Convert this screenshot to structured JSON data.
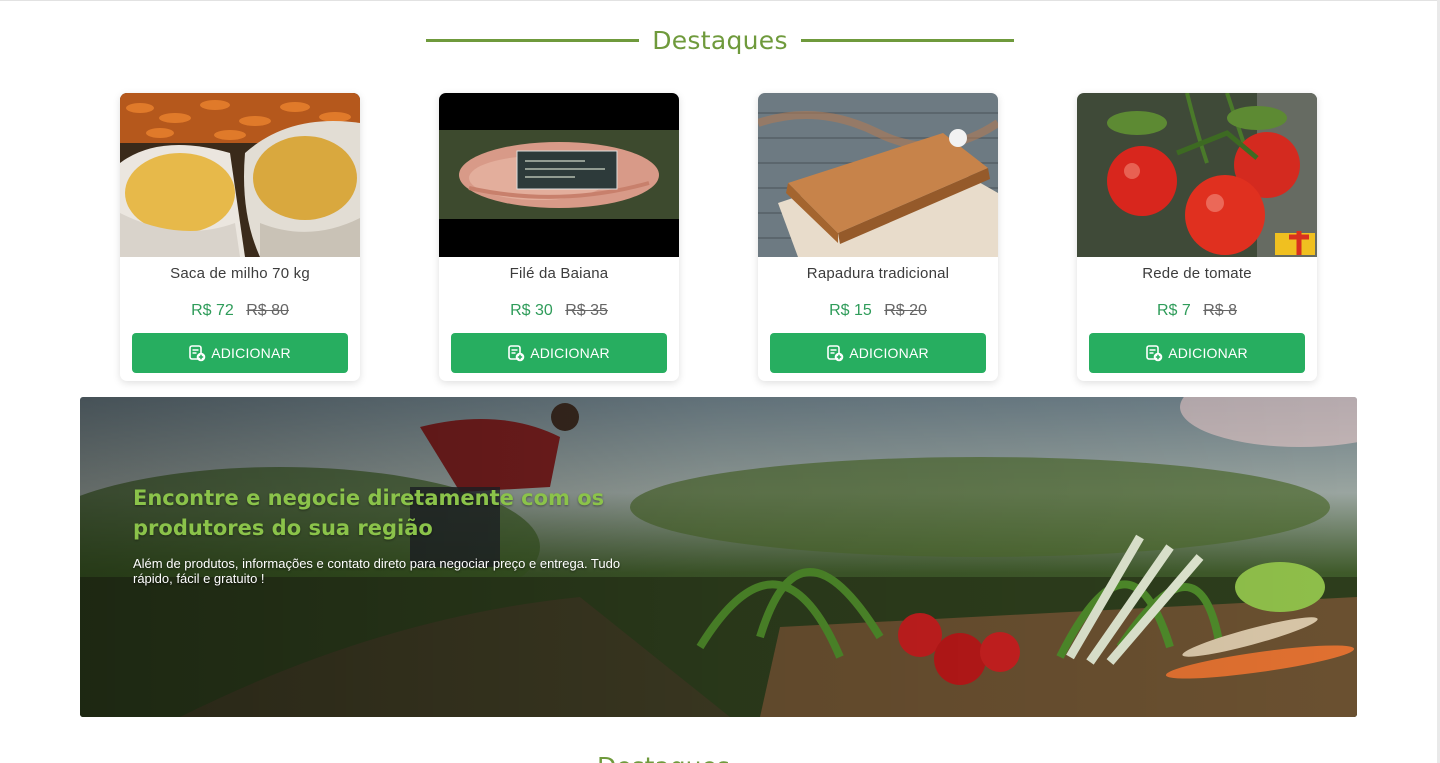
{
  "section": {
    "title": "Destaques"
  },
  "products": [
    {
      "name": "Saca de milho 70 kg",
      "price": "R$ 72",
      "old_price": "R$ 80",
      "button": "ADICIONAR"
    },
    {
      "name": "Filé da Baiana",
      "price": "R$ 30",
      "old_price": "R$ 35",
      "button": "ADICIONAR"
    },
    {
      "name": "Rapadura tradicional",
      "price": "R$ 15",
      "old_price": "R$ 20",
      "button": "ADICIONAR"
    },
    {
      "name": "Rede de tomate",
      "price": "R$ 7",
      "old_price": "R$ 8",
      "button": "ADICIONAR"
    }
  ],
  "banner": {
    "headline": "Encontre e negocie diretamente com os produtores do sua região",
    "subtext": "Além de produtos, informações e contato direto  para negociar preço e entrega. Tudo rápido, fácil e gratuito !"
  },
  "next_section": {
    "title": "Destaques"
  },
  "colors": {
    "accent": "#6f9a3c",
    "button": "#27ae60",
    "price": "#2f9c5a"
  },
  "icons": {
    "add_to_cart": "cart-plus-icon"
  }
}
